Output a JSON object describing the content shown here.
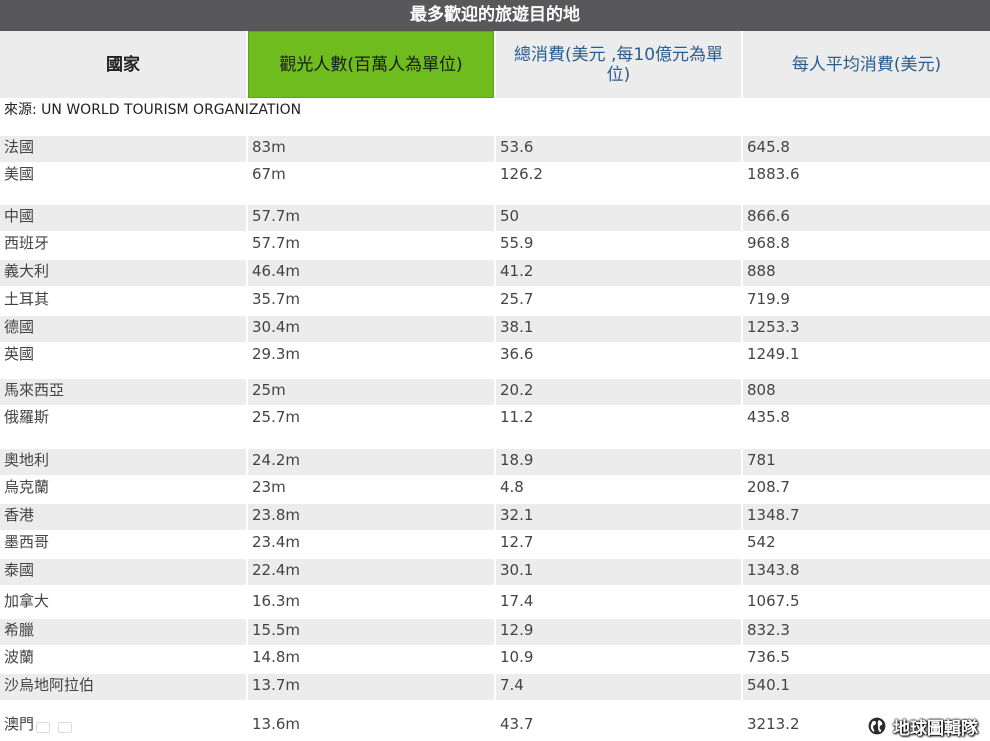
{
  "title": "最多歡迎的旅遊目的地",
  "headers": {
    "country": "國家",
    "arrivals": "觀光人數(百萬人為單位)",
    "spending": "總消費(美元 ,每10億元為單位)",
    "per_capita": "每人平均消費(美元)"
  },
  "source": "來源: UN WORLD TOURISM ORGANIZATION",
  "rows": [
    {
      "country": "法國",
      "arrivals": "83m",
      "spending": "53.6",
      "per_capita": "645.8"
    },
    {
      "country": "美國",
      "arrivals": "67m",
      "spending": "126.2",
      "per_capita": "1883.6"
    },
    {
      "country": "中國",
      "arrivals": "57.7m",
      "spending": "50",
      "per_capita": "866.6"
    },
    {
      "country": "西班牙",
      "arrivals": "57.7m",
      "spending": "55.9",
      "per_capita": "968.8"
    },
    {
      "country": "義大利",
      "arrivals": "46.4m",
      "spending": "41.2",
      "per_capita": "888"
    },
    {
      "country": "土耳其",
      "arrivals": "35.7m",
      "spending": "25.7",
      "per_capita": "719.9"
    },
    {
      "country": "德國",
      "arrivals": "30.4m",
      "spending": "38.1",
      "per_capita": "1253.3"
    },
    {
      "country": "英國",
      "arrivals": "29.3m",
      "spending": "36.6",
      "per_capita": "1249.1"
    },
    {
      "country": "馬來西亞",
      "arrivals": "25m",
      "spending": "20.2",
      "per_capita": "808"
    },
    {
      "country": "俄羅斯",
      "arrivals": "25.7m",
      "spending": "11.2",
      "per_capita": "435.8"
    },
    {
      "country": "奧地利",
      "arrivals": "24.2m",
      "spending": "18.9",
      "per_capita": "781"
    },
    {
      "country": "烏克蘭",
      "arrivals": "23m",
      "spending": "4.8",
      "per_capita": "208.7"
    },
    {
      "country": "香港",
      "arrivals": "23.8m",
      "spending": "32.1",
      "per_capita": "1348.7"
    },
    {
      "country": "墨西哥",
      "arrivals": "23.4m",
      "spending": "12.7",
      "per_capita": "542"
    },
    {
      "country": "泰國",
      "arrivals": "22.4m",
      "spending": "30.1",
      "per_capita": "1343.8"
    },
    {
      "country": "加拿大",
      "arrivals": "16.3m",
      "spending": "17.4",
      "per_capita": "1067.5"
    },
    {
      "country": "希臘",
      "arrivals": "15.5m",
      "spending": "12.9",
      "per_capita": "832.3"
    },
    {
      "country": "波蘭",
      "arrivals": "14.8m",
      "spending": "10.9",
      "per_capita": "736.5"
    },
    {
      "country": "沙烏地阿拉伯",
      "arrivals": "13.7m",
      "spending": "7.4",
      "per_capita": "540.1"
    },
    {
      "country": "澳門",
      "arrivals": "13.6m",
      "spending": "43.7",
      "per_capita": "3213.2"
    }
  ],
  "watermark": "地球圖輯隊",
  "icons": {
    "watermark": "globe-icon"
  }
}
